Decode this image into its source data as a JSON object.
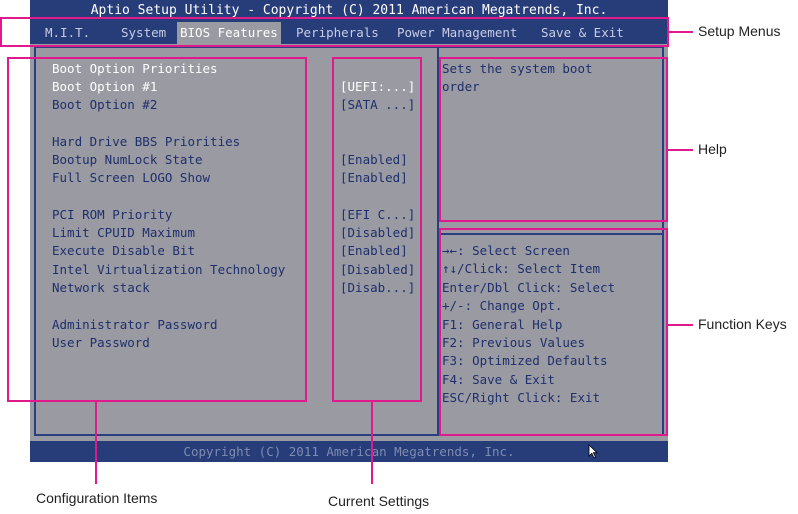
{
  "title_bar": "Aptio Setup Utility - Copyright (C) 2011 American Megatrends, Inc.",
  "menus": [
    {
      "label": "M.I.T."
    },
    {
      "label": "System"
    },
    {
      "label": "BIOS Features",
      "active": true
    },
    {
      "label": "Peripherals"
    },
    {
      "label": "Power Management"
    },
    {
      "label": "Save & Exit"
    }
  ],
  "config_items": {
    "header": "Boot Option Priorities",
    "boot1": "Boot Option #1",
    "boot2": "Boot Option #2",
    "hdd_bbs": "Hard Drive BBS Priorities",
    "numlock": "Bootup NumLock State",
    "logo": "Full Screen LOGO Show",
    "pci_rom": "PCI ROM Priority",
    "cpuid": "Limit CPUID Maximum",
    "xd_bit": "Execute Disable Bit",
    "vt": "Intel Virtualization Technology",
    "network": "Network stack",
    "admin_pw": "Administrator Password",
    "user_pw": "User Password"
  },
  "current_settings": {
    "boot1": "[UEFI:...]",
    "boot2": "[SATA ...]",
    "numlock": "[Enabled]",
    "logo": "[Enabled]",
    "pci_rom": "[EFI C...]",
    "cpuid": "[Disabled]",
    "xd_bit": "[Enabled]",
    "vt": "[Disabled]",
    "network": "[Disab...]"
  },
  "help_text": "Sets the system boot\norder",
  "function_keys": [
    "→←: Select Screen",
    "↑↓/Click: Select Item",
    "Enter/Dbl Click: Select",
    "+/-: Change Opt.",
    "F1: General Help",
    "F2: Previous Values",
    "F3: Optimized Defaults",
    "F4: Save & Exit",
    "ESC/Right Click: Exit"
  ],
  "footer": "Copyright (C) 2011 American Megatrends, Inc.",
  "callouts": {
    "setup_menus": "Setup Menus",
    "help": "Help",
    "function_keys": "Function Keys",
    "configuration_items": "Configuration Items",
    "current_settings": "Current Settings"
  },
  "colors": {
    "bios_bar": "#263d7a",
    "bios_body": "#9a9aa3",
    "highlight": "#e0198c"
  }
}
